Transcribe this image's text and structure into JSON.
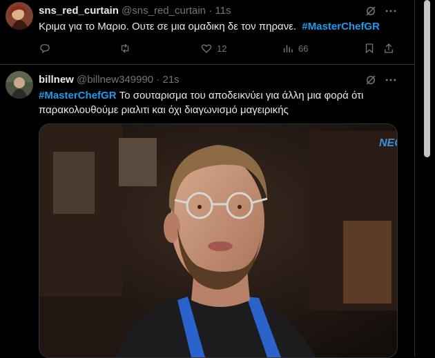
{
  "tweets": [
    {
      "name": "sns_red_curtain",
      "handle": "@sns_red_curtain",
      "separator": "·",
      "time": "11s",
      "text": "Κριμα για το Μαριο. Ουτε σε μια ομαδικη δε τον πηρανε.",
      "hashtag": "#MasterChefGR",
      "likes": "12",
      "views": "66"
    },
    {
      "name": "billnew",
      "handle": "@billnew349990",
      "separator": "·",
      "time": "21s",
      "hashtag": "#MasterChefGR",
      "text_line1": "Το σουταρισμα του αποδεικνύει για άλλη μια φορά ότι",
      "text_line2": "παρακολουθούμε ριαλιτι και όχι διαγωνισμό μαγειρικής",
      "media_overlay": "NEC"
    }
  ],
  "icons": [
    "grok-icon",
    "more-icon",
    "reply-icon",
    "retweet-icon",
    "like-icon",
    "views-icon",
    "bookmark-icon",
    "share-icon"
  ],
  "colors": {
    "background": "#000000",
    "text": "#e7e9ea",
    "secondary": "#71767b",
    "link": "#1d9bf0",
    "border": "#2f3336"
  }
}
